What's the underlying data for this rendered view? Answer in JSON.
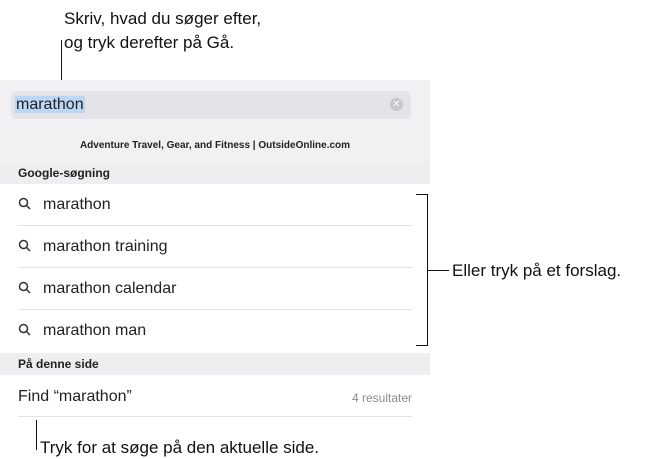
{
  "callouts": {
    "top_line1": "Skriv, hvad du søger efter,",
    "top_line2": "og tryk derefter på Gå.",
    "right": "Eller tryk på et forslag.",
    "bottom": "Tryk for at søge på den aktuelle side."
  },
  "search": {
    "value": "marathon",
    "clear_icon": "clear-icon"
  },
  "top_suggestion": "Adventure Travel, Gear, and Fitness | OutsideOnline.com",
  "google_section": {
    "header": "Google-søgning",
    "items": [
      {
        "label": "marathon",
        "icon": "magnifier-icon"
      },
      {
        "label": "marathon training",
        "icon": "magnifier-icon"
      },
      {
        "label": "marathon calendar",
        "icon": "magnifier-icon"
      },
      {
        "label": "marathon man",
        "icon": "magnifier-icon"
      }
    ]
  },
  "page_section": {
    "header": "På denne side",
    "find_label": "Find “marathon”",
    "result_count": "4 resultater"
  },
  "colors": {
    "selection": "#bcd6f5",
    "band": "#f1f1f3",
    "secondary_text": "#8a8a8f"
  }
}
